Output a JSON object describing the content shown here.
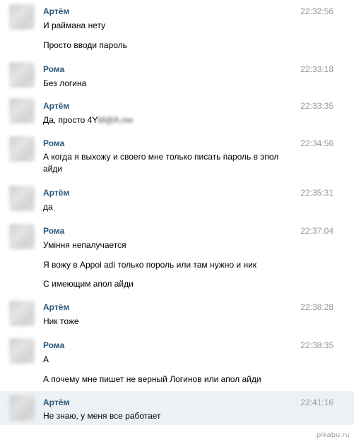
{
  "messages": [
    {
      "author": "Артём",
      "time": "22:32:56",
      "lines": [
        "И раймана нету",
        "Просто вводи пароль"
      ]
    },
    {
      "author": "Рома",
      "time": "22:33:18",
      "lines": [
        "Без логина"
      ]
    },
    {
      "author": "Артём",
      "time": "22:33:35",
      "lines": [
        "Да, просто 4Y"
      ],
      "blurred_tail": "M@A.me"
    },
    {
      "author": "Рома",
      "time": "22:34:56",
      "lines": [
        "А когда я выхожу и своего мне только писать пароль в эпол айди"
      ]
    },
    {
      "author": "Артём",
      "time": "22:35:31",
      "lines": [
        "да"
      ]
    },
    {
      "author": "Рома",
      "time": "22:37:04",
      "lines": [
        "Уміння непалучается",
        "Я вожу в Appol adi только пороль или там нужно и ник",
        "С имеющим апол айди"
      ]
    },
    {
      "author": "Артём",
      "time": "22:38:28",
      "lines": [
        "Ник тоже"
      ]
    },
    {
      "author": "Рома",
      "time": "22:38:35",
      "lines": [
        "А",
        "А почему мне пишет не верный Логинов или апол айди"
      ]
    },
    {
      "author": "Артём",
      "time": "22:41:16",
      "lines": [
        "Не знаю, у меня все работает"
      ],
      "highlighted": true
    }
  ],
  "watermark": "pikabu.ru",
  "colors": {
    "author": "#2b587a",
    "time": "#999999",
    "highlight_bg": "#edf1f5"
  }
}
